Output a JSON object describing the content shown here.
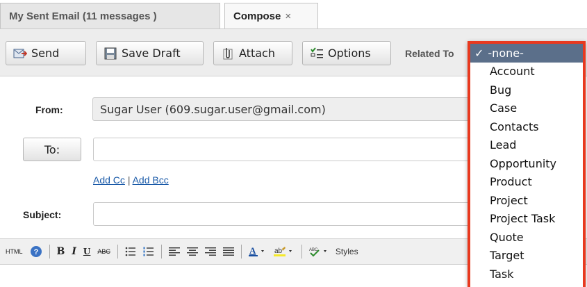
{
  "tabs": [
    {
      "label": "My Sent Email (11 messages )"
    },
    {
      "label": "Compose",
      "close": "×"
    }
  ],
  "toolbar": {
    "send_label": "Send",
    "save_draft_label": "Save Draft",
    "attach_label": "Attach",
    "options_label": "Options",
    "related_to_label": "Related To"
  },
  "form": {
    "from_label": "From:",
    "from_value": "Sugar User (609.sugar.user@gmail.com)",
    "to_label": "To:",
    "to_value": "",
    "add_cc": "Add Cc",
    "separator": "|",
    "add_bcc": "Add Bcc",
    "subject_label": "Subject:",
    "subject_value": ""
  },
  "editor": {
    "html_label": "HTML",
    "bold": "B",
    "italic": "I",
    "underline": "U",
    "strike": "ABC",
    "styles_label": "Styles"
  },
  "related_dropdown": {
    "selected": "-none-",
    "check": "✓",
    "options": [
      "-none-",
      "Account",
      "Bug",
      "Case",
      "Contacts",
      "Lead",
      "Opportunity",
      "Product",
      "Project",
      "Project Task",
      "Quote",
      "Target",
      "Task"
    ]
  },
  "colors": {
    "highlight_border": "#e8391f",
    "selected_bg": "#5b6f8a",
    "link": "#1a5aa8"
  }
}
